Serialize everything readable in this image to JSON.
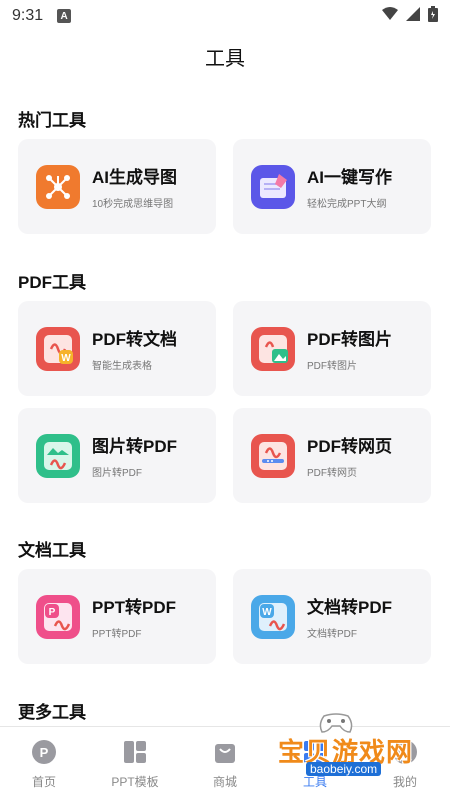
{
  "status_bar": {
    "time": "9:31",
    "notification_badge": "A"
  },
  "header": {
    "title": "工具"
  },
  "sections": [
    {
      "title": "热门工具",
      "cards": [
        {
          "title": "AI生成导图",
          "subtitle": "10秒完成思维导图",
          "icon": "mindmap-icon"
        },
        {
          "title": "AI一键写作",
          "subtitle": "轻松完成PPT大纲",
          "icon": "ai-write-icon"
        }
      ]
    },
    {
      "title": "PDF工具",
      "cards": [
        {
          "title": "PDF转文档",
          "subtitle": "智能生成表格",
          "icon": "pdf-to-word-icon"
        },
        {
          "title": "PDF转图片",
          "subtitle": "PDF转图片",
          "icon": "pdf-to-image-icon"
        },
        {
          "title": "图片转PDF",
          "subtitle": "图片转PDF",
          "icon": "image-to-pdf-icon"
        },
        {
          "title": "PDF转网页",
          "subtitle": "PDF转网页",
          "icon": "pdf-to-web-icon"
        }
      ]
    },
    {
      "title": "文档工具",
      "cards": [
        {
          "title": "PPT转PDF",
          "subtitle": "PPT转PDF",
          "icon": "ppt-to-pdf-icon"
        },
        {
          "title": "文档转PDF",
          "subtitle": "文档转PDF",
          "icon": "word-to-pdf-icon"
        }
      ]
    },
    {
      "title": "更多工具",
      "cards": []
    }
  ],
  "bottom_nav": {
    "items": [
      {
        "label": "首页",
        "icon": "home-icon"
      },
      {
        "label": "PPT模板",
        "icon": "template-icon"
      },
      {
        "label": "商城",
        "icon": "shop-icon"
      },
      {
        "label": "工具",
        "icon": "tools-icon"
      },
      {
        "label": "我的",
        "icon": "profile-icon"
      }
    ]
  },
  "watermark": {
    "text": "宝贝游戏网",
    "url": "baobeiy.com"
  },
  "colors": {
    "accent_orange": "#f08a1a",
    "card_bg": "#f5f5f7",
    "pdf_red": "#e8554e"
  }
}
